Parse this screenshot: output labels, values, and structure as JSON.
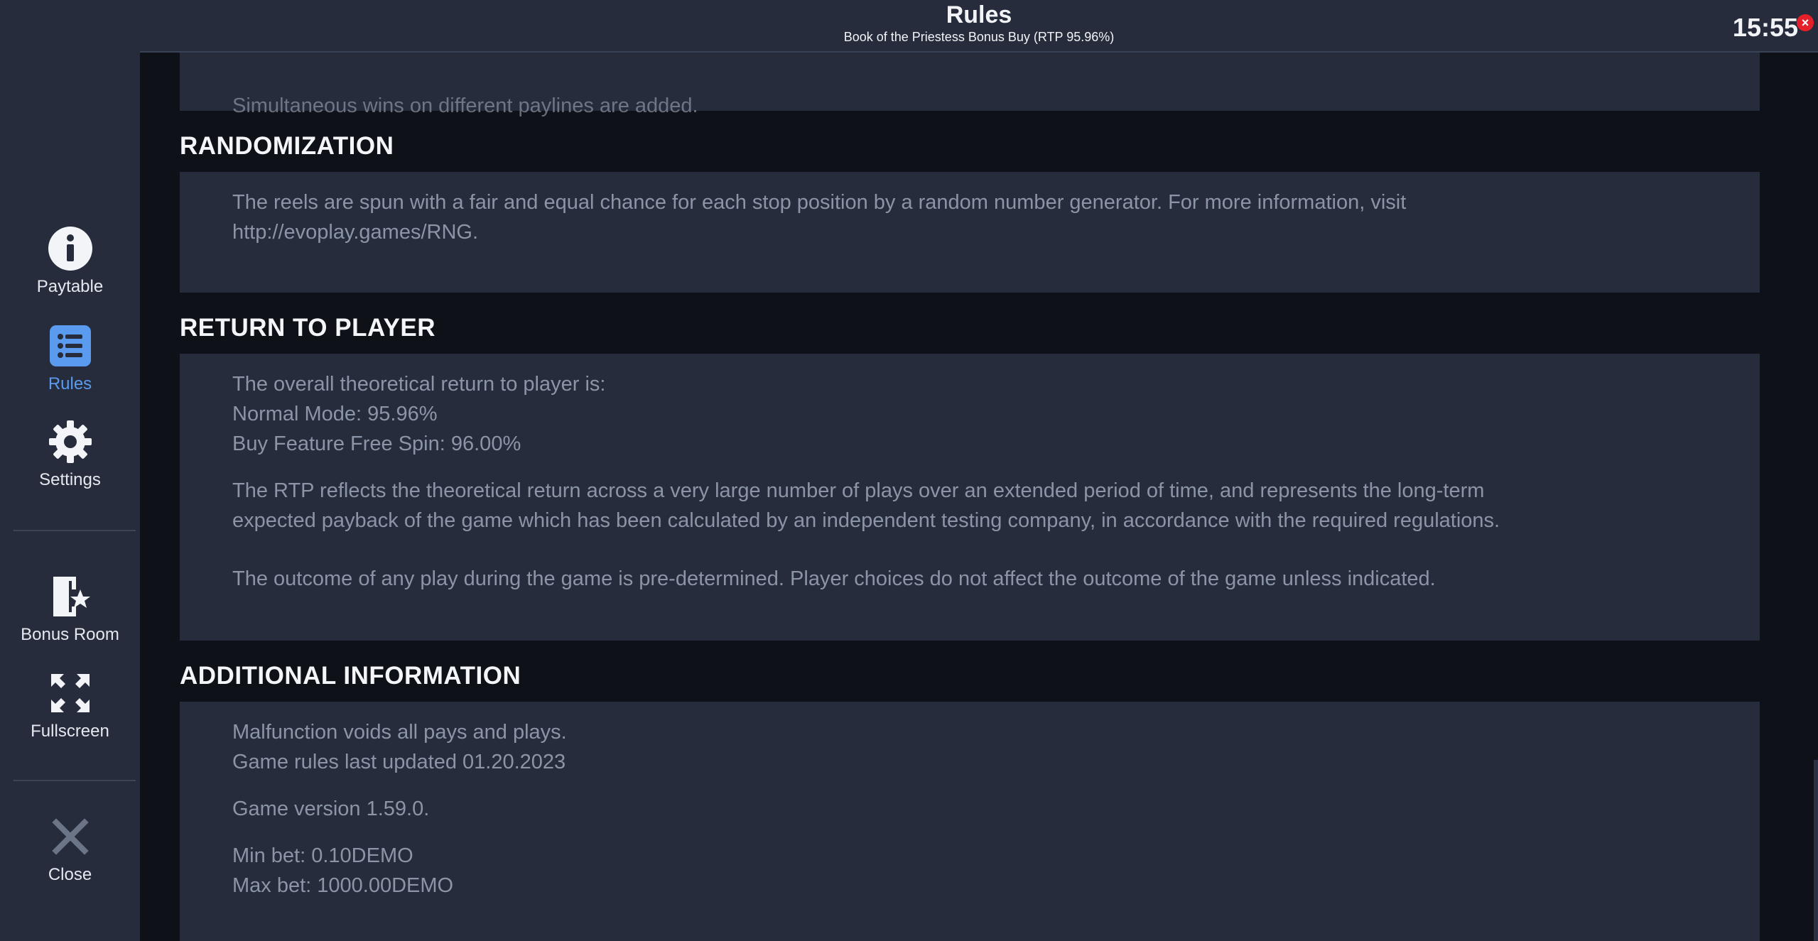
{
  "header": {
    "title": "Rules",
    "subtitle": "Book of the Priestess Bonus Buy (RTP 95.96%)",
    "clock": "15:55",
    "close_glyph": "×"
  },
  "sidebar": {
    "items": [
      {
        "label": "Paytable",
        "icon": "info-icon"
      },
      {
        "label": "Rules",
        "icon": "list-icon"
      },
      {
        "label": "Settings",
        "icon": "gear-icon"
      },
      {
        "label": "Bonus Room",
        "icon": "door-star-icon"
      },
      {
        "label": "Fullscreen",
        "icon": "fullscreen-icon"
      },
      {
        "label": "Close",
        "icon": "close-icon"
      }
    ],
    "active": "Rules",
    "accent": "#5a9bf0"
  },
  "content": {
    "partial_text": "Simultaneous wins on different paylines are added.",
    "randomization": {
      "heading": "RANDOMIZATION",
      "line1": "The reels are spun with a fair and equal chance for each stop position by a random number generator. For more information, visit",
      "line2": "http://evoplay.games/RNG."
    },
    "rtp": {
      "heading": "RETURN TO PLAYER",
      "line1": "The overall theoretical return to player is:",
      "line2": "Normal Mode: 95.96%",
      "line3": "Buy Feature Free Spin: 96.00%",
      "para1_line1": "The RTP reflects the theoretical return across a very large number of plays over an extended period of time, and represents the long-term",
      "para1_line2": "expected payback of the game which has been calculated by an independent testing company, in accordance with the required regulations.",
      "para2": "The outcome of any play during the game is pre-determined. Player choices do not affect the outcome of the game unless indicated."
    },
    "additional": {
      "heading": "ADDITIONAL INFORMATION",
      "line1": "Malfunction voids all pays and plays.",
      "line2": "Game rules last updated 01.20.2023",
      "version": "Game version 1.59.0.",
      "min_bet": "Min bet: 0.10DEMO",
      "max_bet": "Max bet: 1000.00DEMO"
    }
  },
  "colors": {
    "background": "#0e1117",
    "panel": "#262c3b",
    "text": "#8b95a7",
    "heading": "#f3f5f8"
  }
}
